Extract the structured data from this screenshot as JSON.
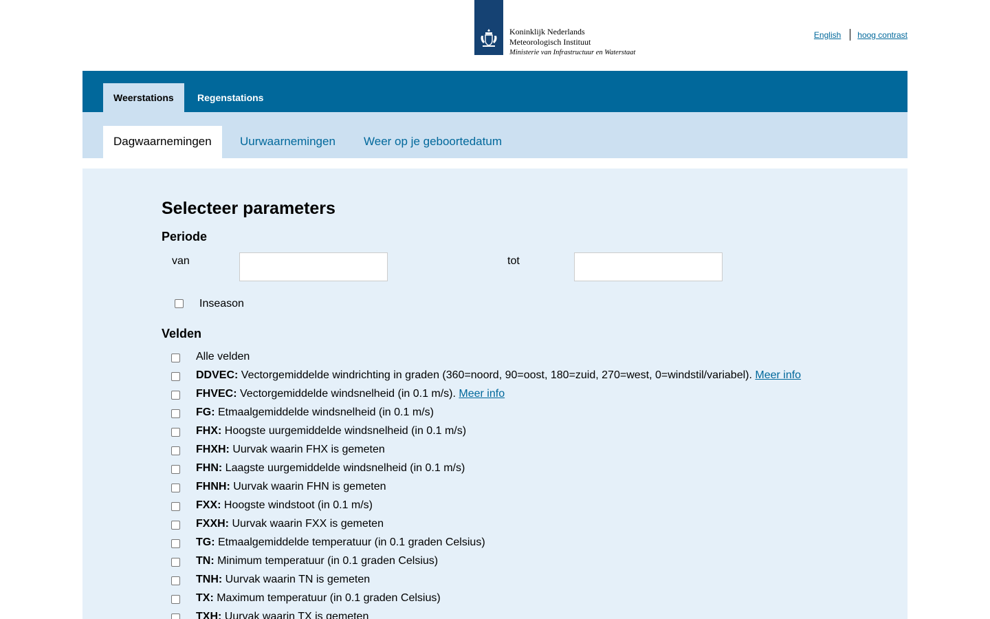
{
  "header": {
    "org_line1": "Koninklijk Nederlands",
    "org_line2": "Meteorologisch Instituut",
    "org_line3": "Ministerie van Infrastructuur en Waterstaat",
    "link_english": "English",
    "link_contrast": "hoog contrast"
  },
  "nav": {
    "primary": [
      "Weerstations",
      "Regenstations"
    ],
    "secondary": [
      "Dagwaarnemingen",
      "Uurwaarnemingen",
      "Weer op je geboortedatum"
    ]
  },
  "form": {
    "title": "Selecteer parameters",
    "period_heading": "Periode",
    "from_label": "van",
    "to_label": "tot",
    "from_value": "",
    "to_value": "",
    "inseason_label": "Inseason",
    "fields_heading": "Velden",
    "all_fields_label": "Alle velden",
    "fields": [
      {
        "code": "DDVEC:",
        "desc": " Vectorgemiddelde windrichting in graden (360=noord, 90=oost, 180=zuid, 270=west, 0=windstil/variabel). ",
        "link": "Meer info"
      },
      {
        "code": "FHVEC:",
        "desc": " Vectorgemiddelde windsnelheid (in 0.1 m/s). ",
        "link": "Meer info"
      },
      {
        "code": "FG:",
        "desc": " Etmaalgemiddelde windsnelheid (in 0.1 m/s)",
        "link": ""
      },
      {
        "code": "FHX:",
        "desc": " Hoogste uurgemiddelde windsnelheid (in 0.1 m/s)",
        "link": ""
      },
      {
        "code": "FHXH:",
        "desc": " Uurvak waarin FHX is gemeten",
        "link": ""
      },
      {
        "code": "FHN:",
        "desc": " Laagste uurgemiddelde windsnelheid (in 0.1 m/s)",
        "link": ""
      },
      {
        "code": "FHNH:",
        "desc": " Uurvak waarin FHN is gemeten",
        "link": ""
      },
      {
        "code": "FXX:",
        "desc": " Hoogste windstoot (in 0.1 m/s)",
        "link": ""
      },
      {
        "code": "FXXH:",
        "desc": " Uurvak waarin FXX is gemeten",
        "link": ""
      },
      {
        "code": "TG:",
        "desc": " Etmaalgemiddelde temperatuur (in 0.1 graden Celsius)",
        "link": ""
      },
      {
        "code": "TN:",
        "desc": " Minimum temperatuur (in 0.1 graden Celsius)",
        "link": ""
      },
      {
        "code": "TNH:",
        "desc": " Uurvak waarin TN is gemeten",
        "link": ""
      },
      {
        "code": "TX:",
        "desc": " Maximum temperatuur (in 0.1 graden Celsius)",
        "link": ""
      },
      {
        "code": "TXH:",
        "desc": " Uurvak waarin TX is gemeten",
        "link": ""
      }
    ]
  },
  "colors": {
    "brand_dark": "#154273",
    "nav_blue": "#01689b",
    "nav_light": "#cce0f1",
    "panel_bg": "#e5f0f9"
  }
}
